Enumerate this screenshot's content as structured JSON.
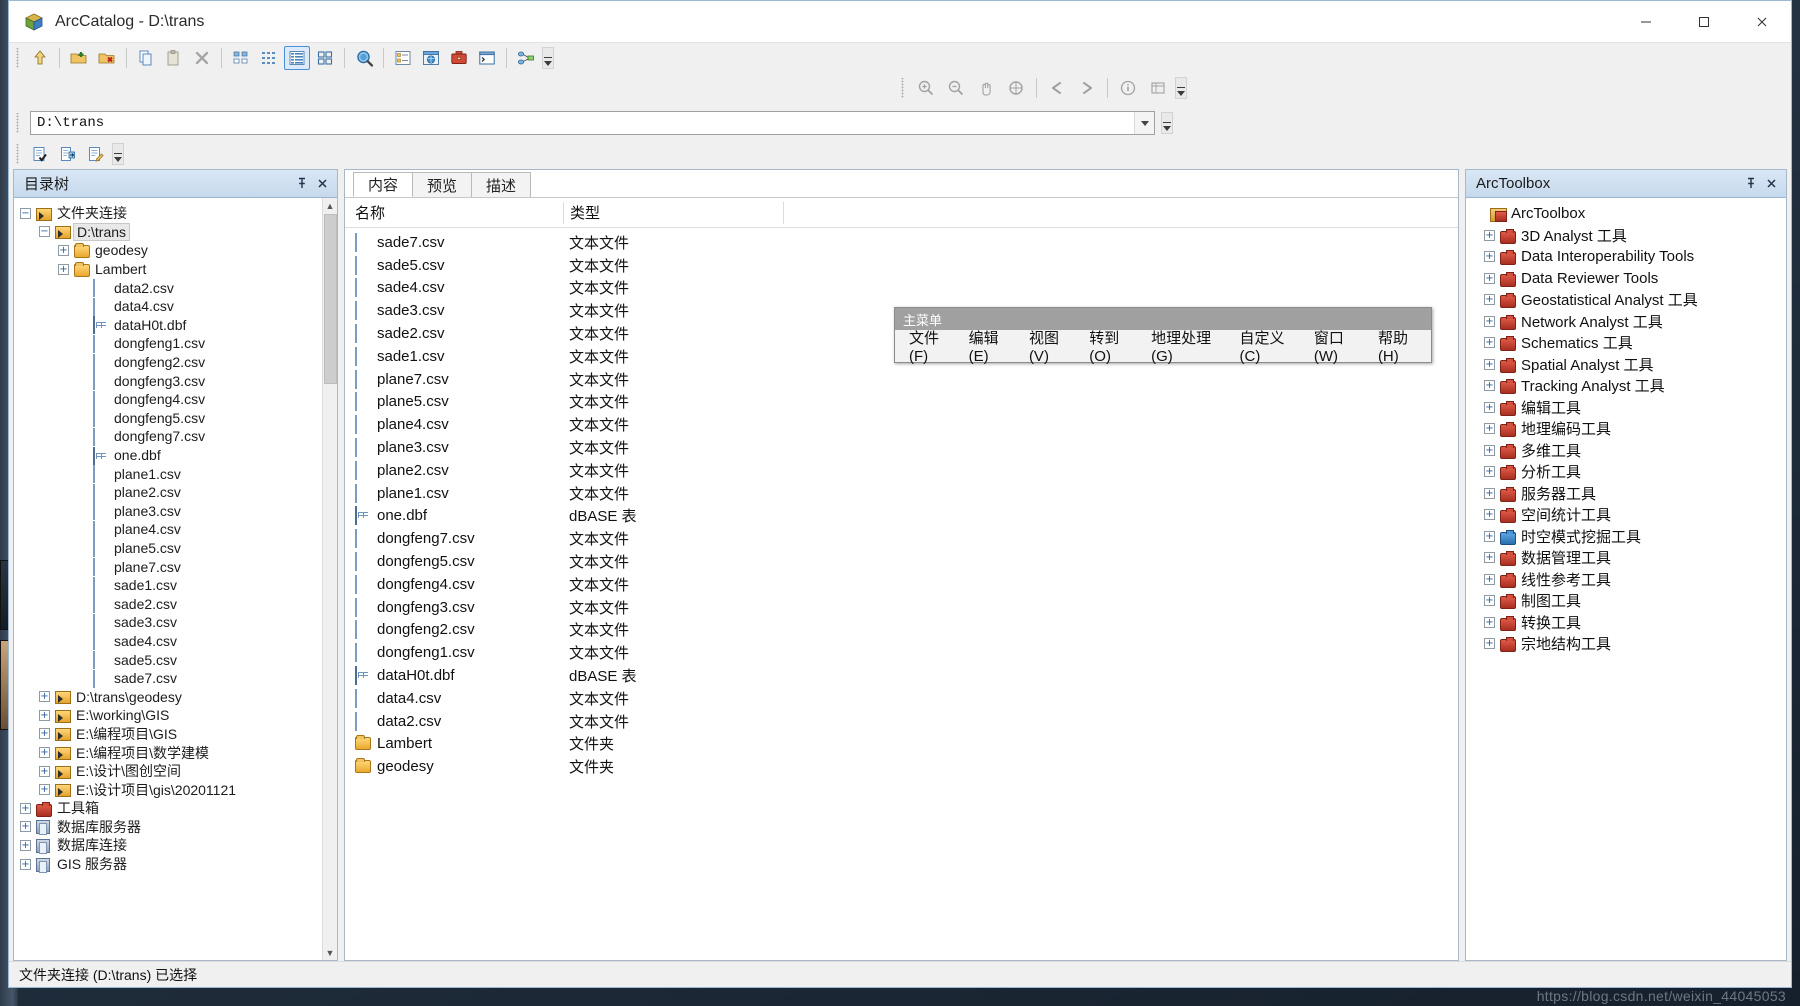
{
  "window": {
    "title": "ArcCatalog - D:\\trans",
    "app_icon": "arccatalog-icon",
    "minimize": "—",
    "maximize": "▢",
    "close": "✕"
  },
  "address": {
    "value": "D:\\trans",
    "placeholder": "D:\\trans"
  },
  "toolbar": {
    "buttons": [
      {
        "name": "up-one-level-icon",
        "tip": "Up One Level"
      },
      {
        "name": "connect-to-folder-icon",
        "tip": "Connect To Folder"
      },
      {
        "name": "disconnect-from-folder-icon",
        "tip": "Disconnect From Folder"
      },
      {
        "name": "copy-icon",
        "tip": "Copy"
      },
      {
        "name": "paste-icon",
        "tip": "Paste"
      },
      {
        "name": "delete-icon",
        "tip": "Delete"
      },
      {
        "name": "large-icons-view-icon",
        "tip": "Large Icons"
      },
      {
        "name": "list-view-icon",
        "tip": "List"
      },
      {
        "name": "details-view-icon",
        "tip": "Details"
      },
      {
        "name": "thumbnails-view-icon",
        "tip": "Thumbnails"
      },
      {
        "name": "search-icon",
        "tip": "Search"
      },
      {
        "name": "catalog-tree-icon",
        "tip": "Catalog Tree"
      },
      {
        "name": "arcmap-icon",
        "tip": "ArcMap"
      },
      {
        "name": "arctoolbox-icon",
        "tip": "ArcToolbox"
      },
      {
        "name": "python-window-icon",
        "tip": "Python Window"
      },
      {
        "name": "model-builder-icon",
        "tip": "ModelBuilder"
      }
    ],
    "geoprocessing_buttons": [
      {
        "name": "zoom-in-icon"
      },
      {
        "name": "zoom-out-icon"
      },
      {
        "name": "pan-icon"
      },
      {
        "name": "full-extent-icon"
      },
      {
        "name": "back-icon"
      },
      {
        "name": "forward-icon"
      },
      {
        "name": "identify-icon"
      },
      {
        "name": "attributes-icon"
      }
    ],
    "row3_buttons": [
      {
        "name": "new-metadata-icon"
      },
      {
        "name": "import-metadata-icon"
      },
      {
        "name": "edit-metadata-icon"
      }
    ]
  },
  "tree_panel": {
    "title": "目录树",
    "pin_icon": "pin-icon",
    "close_icon": "close-icon",
    "items": [
      {
        "label": "文件夹连接",
        "icon": "folder-connection-icon",
        "indent": 0,
        "expander": "−"
      },
      {
        "label": "D:\\trans",
        "icon": "folder-connection-icon",
        "indent": 1,
        "expander": "−",
        "selected": true
      },
      {
        "label": "geodesy",
        "icon": "folder-icon",
        "indent": 2,
        "expander": "+"
      },
      {
        "label": "Lambert",
        "icon": "folder-icon",
        "indent": 2,
        "expander": "+"
      },
      {
        "label": "data2.csv",
        "icon": "csv-file-icon",
        "indent": 3,
        "expander": ""
      },
      {
        "label": "data4.csv",
        "icon": "csv-file-icon",
        "indent": 3,
        "expander": ""
      },
      {
        "label": "dataH0t.dbf",
        "icon": "dbf-table-icon",
        "indent": 3,
        "expander": ""
      },
      {
        "label": "dongfeng1.csv",
        "icon": "csv-file-icon",
        "indent": 3,
        "expander": ""
      },
      {
        "label": "dongfeng2.csv",
        "icon": "csv-file-icon",
        "indent": 3,
        "expander": ""
      },
      {
        "label": "dongfeng3.csv",
        "icon": "csv-file-icon",
        "indent": 3,
        "expander": ""
      },
      {
        "label": "dongfeng4.csv",
        "icon": "csv-file-icon",
        "indent": 3,
        "expander": ""
      },
      {
        "label": "dongfeng5.csv",
        "icon": "csv-file-icon",
        "indent": 3,
        "expander": ""
      },
      {
        "label": "dongfeng7.csv",
        "icon": "csv-file-icon",
        "indent": 3,
        "expander": ""
      },
      {
        "label": "one.dbf",
        "icon": "dbf-table-icon",
        "indent": 3,
        "expander": ""
      },
      {
        "label": "plane1.csv",
        "icon": "csv-file-icon",
        "indent": 3,
        "expander": ""
      },
      {
        "label": "plane2.csv",
        "icon": "csv-file-icon",
        "indent": 3,
        "expander": ""
      },
      {
        "label": "plane3.csv",
        "icon": "csv-file-icon",
        "indent": 3,
        "expander": ""
      },
      {
        "label": "plane4.csv",
        "icon": "csv-file-icon",
        "indent": 3,
        "expander": ""
      },
      {
        "label": "plane5.csv",
        "icon": "csv-file-icon",
        "indent": 3,
        "expander": ""
      },
      {
        "label": "plane7.csv",
        "icon": "csv-file-icon",
        "indent": 3,
        "expander": ""
      },
      {
        "label": "sade1.csv",
        "icon": "csv-file-icon",
        "indent": 3,
        "expander": ""
      },
      {
        "label": "sade2.csv",
        "icon": "csv-file-icon",
        "indent": 3,
        "expander": ""
      },
      {
        "label": "sade3.csv",
        "icon": "csv-file-icon",
        "indent": 3,
        "expander": ""
      },
      {
        "label": "sade4.csv",
        "icon": "csv-file-icon",
        "indent": 3,
        "expander": ""
      },
      {
        "label": "sade5.csv",
        "icon": "csv-file-icon",
        "indent": 3,
        "expander": ""
      },
      {
        "label": "sade7.csv",
        "icon": "csv-file-icon",
        "indent": 3,
        "expander": ""
      },
      {
        "label": "D:\\trans\\geodesy",
        "icon": "folder-connection-icon",
        "indent": 1,
        "expander": "+"
      },
      {
        "label": "E:\\working\\GIS",
        "icon": "folder-connection-icon",
        "indent": 1,
        "expander": "+"
      },
      {
        "label": "E:\\编程项目\\GIS",
        "icon": "folder-connection-icon",
        "indent": 1,
        "expander": "+"
      },
      {
        "label": "E:\\编程项目\\数学建模",
        "icon": "folder-connection-icon",
        "indent": 1,
        "expander": "+"
      },
      {
        "label": "E:\\设计\\图创空间",
        "icon": "folder-connection-icon",
        "indent": 1,
        "expander": "+"
      },
      {
        "label": "E:\\设计项目\\gis\\20201121",
        "icon": "folder-connection-icon",
        "indent": 1,
        "expander": "+"
      },
      {
        "label": "工具箱",
        "icon": "toolbox-icon",
        "indent": 0,
        "expander": "+"
      },
      {
        "label": "数据库服务器",
        "icon": "database-server-icon",
        "indent": 0,
        "expander": "+"
      },
      {
        "label": "数据库连接",
        "icon": "database-connection-icon",
        "indent": 0,
        "expander": "+"
      },
      {
        "label": "GIS 服务器",
        "icon": "gis-server-icon",
        "indent": 0,
        "expander": "+"
      }
    ]
  },
  "content_panel": {
    "tabs": [
      {
        "label": "内容",
        "active": true
      },
      {
        "label": "预览",
        "active": false
      },
      {
        "label": "描述",
        "active": false
      }
    ],
    "columns": [
      "名称",
      "类型"
    ],
    "rows": [
      {
        "name": "sade7.csv",
        "type": "文本文件",
        "icon": "csv-file-icon"
      },
      {
        "name": "sade5.csv",
        "type": "文本文件",
        "icon": "csv-file-icon"
      },
      {
        "name": "sade4.csv",
        "type": "文本文件",
        "icon": "csv-file-icon"
      },
      {
        "name": "sade3.csv",
        "type": "文本文件",
        "icon": "csv-file-icon"
      },
      {
        "name": "sade2.csv",
        "type": "文本文件",
        "icon": "csv-file-icon"
      },
      {
        "name": "sade1.csv",
        "type": "文本文件",
        "icon": "csv-file-icon"
      },
      {
        "name": "plane7.csv",
        "type": "文本文件",
        "icon": "csv-file-icon"
      },
      {
        "name": "plane5.csv",
        "type": "文本文件",
        "icon": "csv-file-icon"
      },
      {
        "name": "plane4.csv",
        "type": "文本文件",
        "icon": "csv-file-icon"
      },
      {
        "name": "plane3.csv",
        "type": "文本文件",
        "icon": "csv-file-icon"
      },
      {
        "name": "plane2.csv",
        "type": "文本文件",
        "icon": "csv-file-icon"
      },
      {
        "name": "plane1.csv",
        "type": "文本文件",
        "icon": "csv-file-icon"
      },
      {
        "name": "one.dbf",
        "type": "dBASE 表",
        "icon": "dbf-table-icon"
      },
      {
        "name": "dongfeng7.csv",
        "type": "文本文件",
        "icon": "csv-file-icon"
      },
      {
        "name": "dongfeng5.csv",
        "type": "文本文件",
        "icon": "csv-file-icon"
      },
      {
        "name": "dongfeng4.csv",
        "type": "文本文件",
        "icon": "csv-file-icon"
      },
      {
        "name": "dongfeng3.csv",
        "type": "文本文件",
        "icon": "csv-file-icon"
      },
      {
        "name": "dongfeng2.csv",
        "type": "文本文件",
        "icon": "csv-file-icon"
      },
      {
        "name": "dongfeng1.csv",
        "type": "文本文件",
        "icon": "csv-file-icon"
      },
      {
        "name": "dataH0t.dbf",
        "type": "dBASE 表",
        "icon": "dbf-table-icon"
      },
      {
        "name": "data4.csv",
        "type": "文本文件",
        "icon": "csv-file-icon"
      },
      {
        "name": "data2.csv",
        "type": "文本文件",
        "icon": "csv-file-icon"
      },
      {
        "name": "Lambert",
        "type": "文件夹",
        "icon": "folder-icon"
      },
      {
        "name": "geodesy",
        "type": "文件夹",
        "icon": "folder-icon"
      }
    ]
  },
  "toolbox_panel": {
    "title": "ArcToolbox",
    "pin_icon": "pin-icon",
    "close_icon": "close-icon",
    "items": [
      {
        "label": "ArcToolbox",
        "icon": "arctoolbox-root-icon",
        "expander": "",
        "root": true
      },
      {
        "label": "3D Analyst 工具",
        "icon": "toolbox-icon",
        "expander": "+"
      },
      {
        "label": "Data Interoperability Tools",
        "icon": "toolbox-icon",
        "expander": "+"
      },
      {
        "label": "Data Reviewer Tools",
        "icon": "toolbox-icon",
        "expander": "+"
      },
      {
        "label": "Geostatistical Analyst 工具",
        "icon": "toolbox-icon",
        "expander": "+"
      },
      {
        "label": "Network Analyst 工具",
        "icon": "toolbox-icon",
        "expander": "+"
      },
      {
        "label": "Schematics 工具",
        "icon": "toolbox-icon",
        "expander": "+"
      },
      {
        "label": "Spatial Analyst 工具",
        "icon": "toolbox-icon",
        "expander": "+"
      },
      {
        "label": "Tracking Analyst 工具",
        "icon": "toolbox-icon",
        "expander": "+"
      },
      {
        "label": "编辑工具",
        "icon": "toolbox-icon",
        "expander": "+"
      },
      {
        "label": "地理编码工具",
        "icon": "toolbox-icon",
        "expander": "+"
      },
      {
        "label": "多维工具",
        "icon": "toolbox-icon",
        "expander": "+"
      },
      {
        "label": "分析工具",
        "icon": "toolbox-icon",
        "expander": "+"
      },
      {
        "label": "服务器工具",
        "icon": "toolbox-icon",
        "expander": "+"
      },
      {
        "label": "空间统计工具",
        "icon": "toolbox-icon",
        "expander": "+"
      },
      {
        "label": "时空模式挖掘工具",
        "icon": "toolbox-blue-icon",
        "expander": "+"
      },
      {
        "label": "数据管理工具",
        "icon": "toolbox-icon",
        "expander": "+"
      },
      {
        "label": "线性参考工具",
        "icon": "toolbox-icon",
        "expander": "+"
      },
      {
        "label": "制图工具",
        "icon": "toolbox-icon",
        "expander": "+"
      },
      {
        "label": "转换工具",
        "icon": "toolbox-icon",
        "expander": "+"
      },
      {
        "label": "宗地结构工具",
        "icon": "toolbox-icon",
        "expander": "+"
      }
    ]
  },
  "float_menu": {
    "title": "主菜单",
    "items": [
      "文件(F)",
      "编辑(E)",
      "视图(V)",
      "转到(O)",
      "地理处理(G)",
      "自定义(C)",
      "窗口(W)",
      "帮助(H)"
    ]
  },
  "statusbar": {
    "text": "文件夹连接 (D:\\trans) 已选择"
  },
  "watermark": {
    "text": "https://blog.csdn.net/weixin_44045053"
  },
  "colors": {
    "accent": "#4a90d9",
    "panel_header": "#c6d9ec",
    "selection": "#e8e8e8",
    "dbf_green": "#22c322",
    "toolbox_red": "#a92f20"
  }
}
